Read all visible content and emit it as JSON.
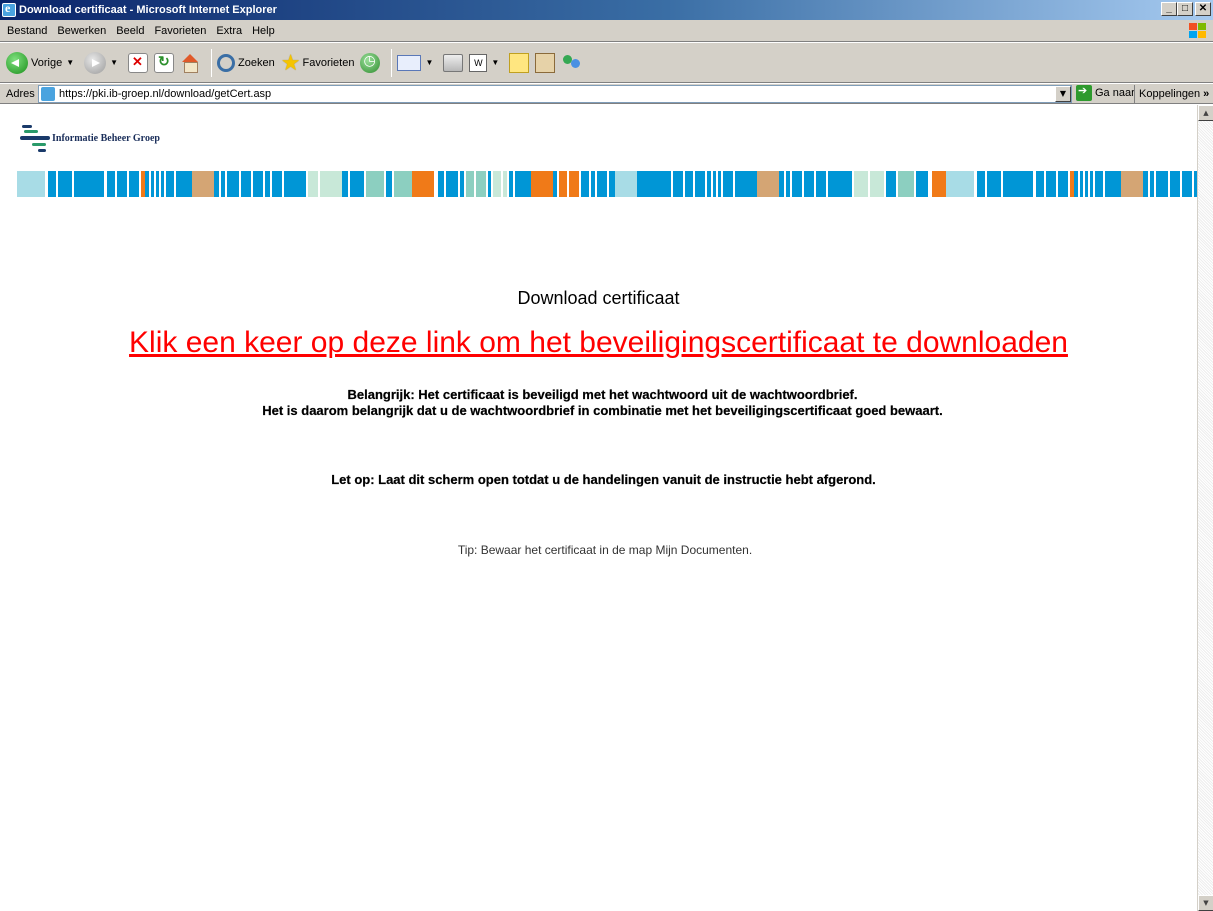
{
  "window": {
    "title": "Download certificaat - Microsoft Internet Explorer",
    "buttons": [
      "_",
      "□",
      "✕"
    ]
  },
  "menu": [
    "Bestand",
    "Bewerken",
    "Beeld",
    "Favorieten",
    "Extra",
    "Help"
  ],
  "toolbar": {
    "back_label": "Vorige",
    "search_label": "Zoeken",
    "favorites_label": "Favorieten",
    "edit_glyph": "W"
  },
  "address": {
    "label": "Adres",
    "url": "https://pki.ib-groep.nl/download/getCert.asp",
    "go_label": "Ga naar",
    "links_label": "Koppelingen",
    "links_chevron": "»"
  },
  "page": {
    "logo_text": "Informatie Beheer Groep",
    "heading": "Download certificaat",
    "download_link": "Klik een keer op deze link om het beveiligingscertificaat te downloaden",
    "important_line1": "Belangrijk: Het certificaat is beveiligd met het wachtwoord uit de wachtwoordbrief.",
    "important_line2": "Het is daarom belangrijk dat u de wachtwoordbrief in combinatie met het beveiligingscertificaat goed bewaart.",
    "let_op": "Let op: Laat dit scherm open totdat u de handelingen vanuit de instructie hebt afgerond.",
    "tip": "Tip: Bewaar het certificaat in de map Mijn Documenten."
  },
  "colors": {
    "link": "#ff0000",
    "stripe_palette": [
      "#a8dce6",
      "#0096d6",
      "#f07a18",
      "#d4a574",
      "#c8e8d8",
      "#8ccfc0",
      "#ffffff"
    ]
  }
}
